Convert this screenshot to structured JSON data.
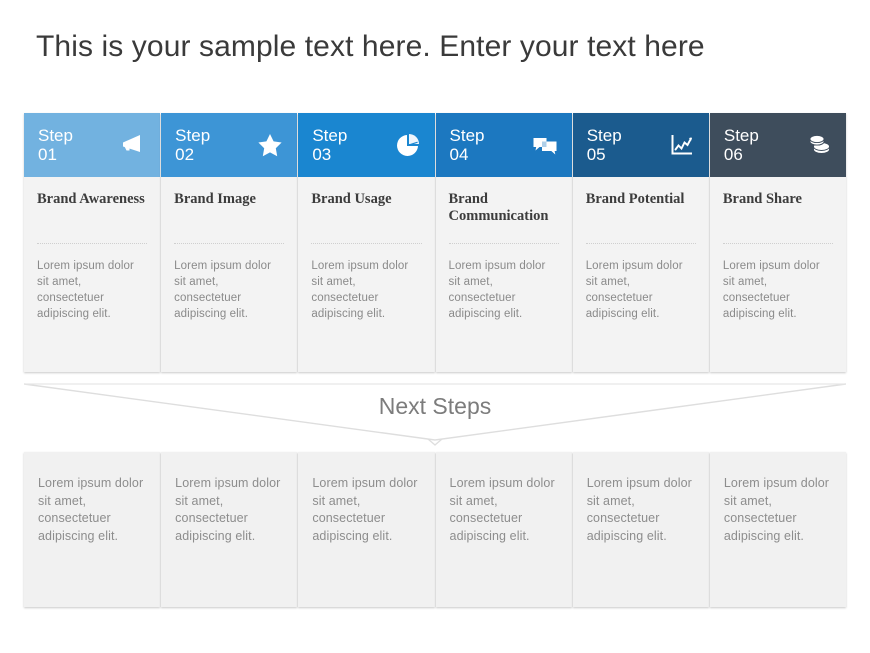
{
  "title": "This is your sample text here. Enter your text here",
  "next_steps": {
    "label": "Next Steps"
  },
  "colors": {
    "step1": "#72b2e0",
    "step2": "#3d95d6",
    "step3": "#1a86d0",
    "step4": "#1c78c0",
    "step5": "#1b5b8e",
    "step6": "#3e4d5c",
    "title_text": "#3a3a3a",
    "body_text": "#8a8a8a",
    "card_bg": "#f3f3f3",
    "next_card_bg": "#f1f1f1",
    "next_steps_text": "#7c7c7c"
  },
  "steps": [
    {
      "step_label": "Step\n01",
      "step_number": "01",
      "name": "Brand Awareness",
      "icon": "megaphone-icon",
      "color": "#72b2e0",
      "description": "Lorem ipsum dolor sit amet, consectetuer adipiscing elit."
    },
    {
      "step_label": "Step\n02",
      "step_number": "02",
      "name": "Brand Image",
      "icon": "star-icon",
      "color": "#3d95d6",
      "description": "Lorem ipsum dolor sit amet, consectetuer adipiscing elit."
    },
    {
      "step_label": "Step\n03",
      "step_number": "03",
      "name": "Brand Usage",
      "icon": "pie-chart-icon",
      "color": "#1a86d0",
      "description": "Lorem ipsum dolor sit amet, consectetuer adipiscing elit."
    },
    {
      "step_label": "Step\n04",
      "step_number": "04",
      "name": "Brand Communication",
      "icon": "speech-bubbles-icon",
      "color": "#1c78c0",
      "description": "Lorem ipsum dolor sit amet, consectetuer adipiscing elit."
    },
    {
      "step_label": "Step\n05",
      "step_number": "05",
      "name": "Brand Potential",
      "icon": "growth-chart-icon",
      "color": "#1b5b8e",
      "description": "Lorem ipsum dolor sit amet, consectetuer adipiscing elit."
    },
    {
      "step_label": "Step\n06",
      "step_number": "06",
      "name": "Brand Share",
      "icon": "coins-icon",
      "color": "#3e4d5c",
      "description": "Lorem ipsum dolor sit amet, consectetuer adipiscing elit."
    }
  ],
  "next_cards": [
    {
      "description": "Lorem ipsum dolor sit amet, consectetuer adipiscing elit."
    },
    {
      "description": "Lorem ipsum dolor sit amet, consectetuer adipiscing elit."
    },
    {
      "description": "Lorem ipsum dolor sit amet, consectetuer adipiscing elit."
    },
    {
      "description": "Lorem ipsum dolor sit amet, consectetuer adipiscing elit."
    },
    {
      "description": "Lorem ipsum dolor sit amet, consectetuer adipiscing elit."
    },
    {
      "description": "Lorem ipsum dolor sit amet, consectetuer adipiscing elit."
    }
  ]
}
